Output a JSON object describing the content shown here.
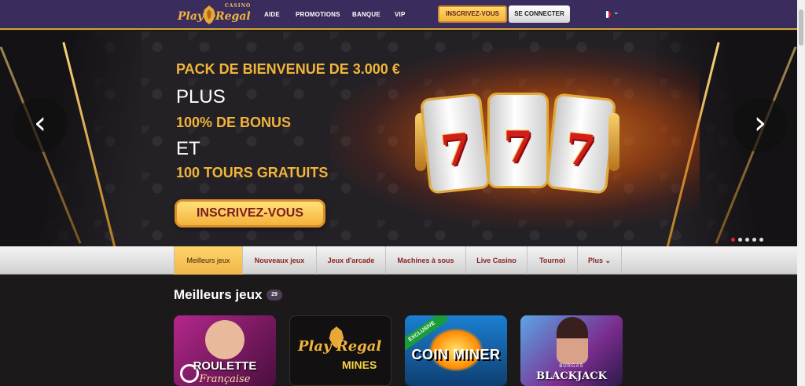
{
  "header": {
    "logo": {
      "play": "Play",
      "regal": "Regal",
      "casino": "CASINO"
    },
    "nav": [
      "AIDE",
      "PROMOTIONS",
      "BANQUE",
      "VIP"
    ],
    "signup_label": "INSCRIVEZ-VOUS",
    "login_label": "SE CONNECTER",
    "language": "fr",
    "language_icon": "france-flag-icon"
  },
  "hero": {
    "line1": "PACK DE BIENVENUE DE 3.000 €",
    "line2": "PLUS",
    "line3": "100% DE BONUS",
    "line4": "ET",
    "line5": "100 TOURS GRATUITS",
    "cta_label": "INSCRIVEZ-VOUS",
    "reel_symbol": "7",
    "slides_total": 5,
    "active_slide": 1
  },
  "tabs": [
    {
      "label": "Meilleurs jeux",
      "active": true
    },
    {
      "label": "Nouveaux jeux"
    },
    {
      "label": "Jeux d'arcade"
    },
    {
      "label": "Machines à sous"
    },
    {
      "label": "Live Casino"
    },
    {
      "label": "Tournoi"
    },
    {
      "label": "Plus"
    }
  ],
  "games_section": {
    "title": "Meilleurs jeux",
    "count": "29",
    "cards": [
      {
        "title": "ROULETTE",
        "subtitle": "Française"
      },
      {
        "title": "Play Regal",
        "subtitle": "MINES"
      },
      {
        "title": "COIN MINER",
        "badge": "EXCLUSIVE"
      },
      {
        "title": "BLACKJACK",
        "subtitle": "BURGAS"
      }
    ]
  },
  "colors": {
    "header_bg": "#3a2d5e",
    "gold": "#f2b43a",
    "active_tab": "#f0b64a",
    "page_bg": "#1c191b"
  }
}
